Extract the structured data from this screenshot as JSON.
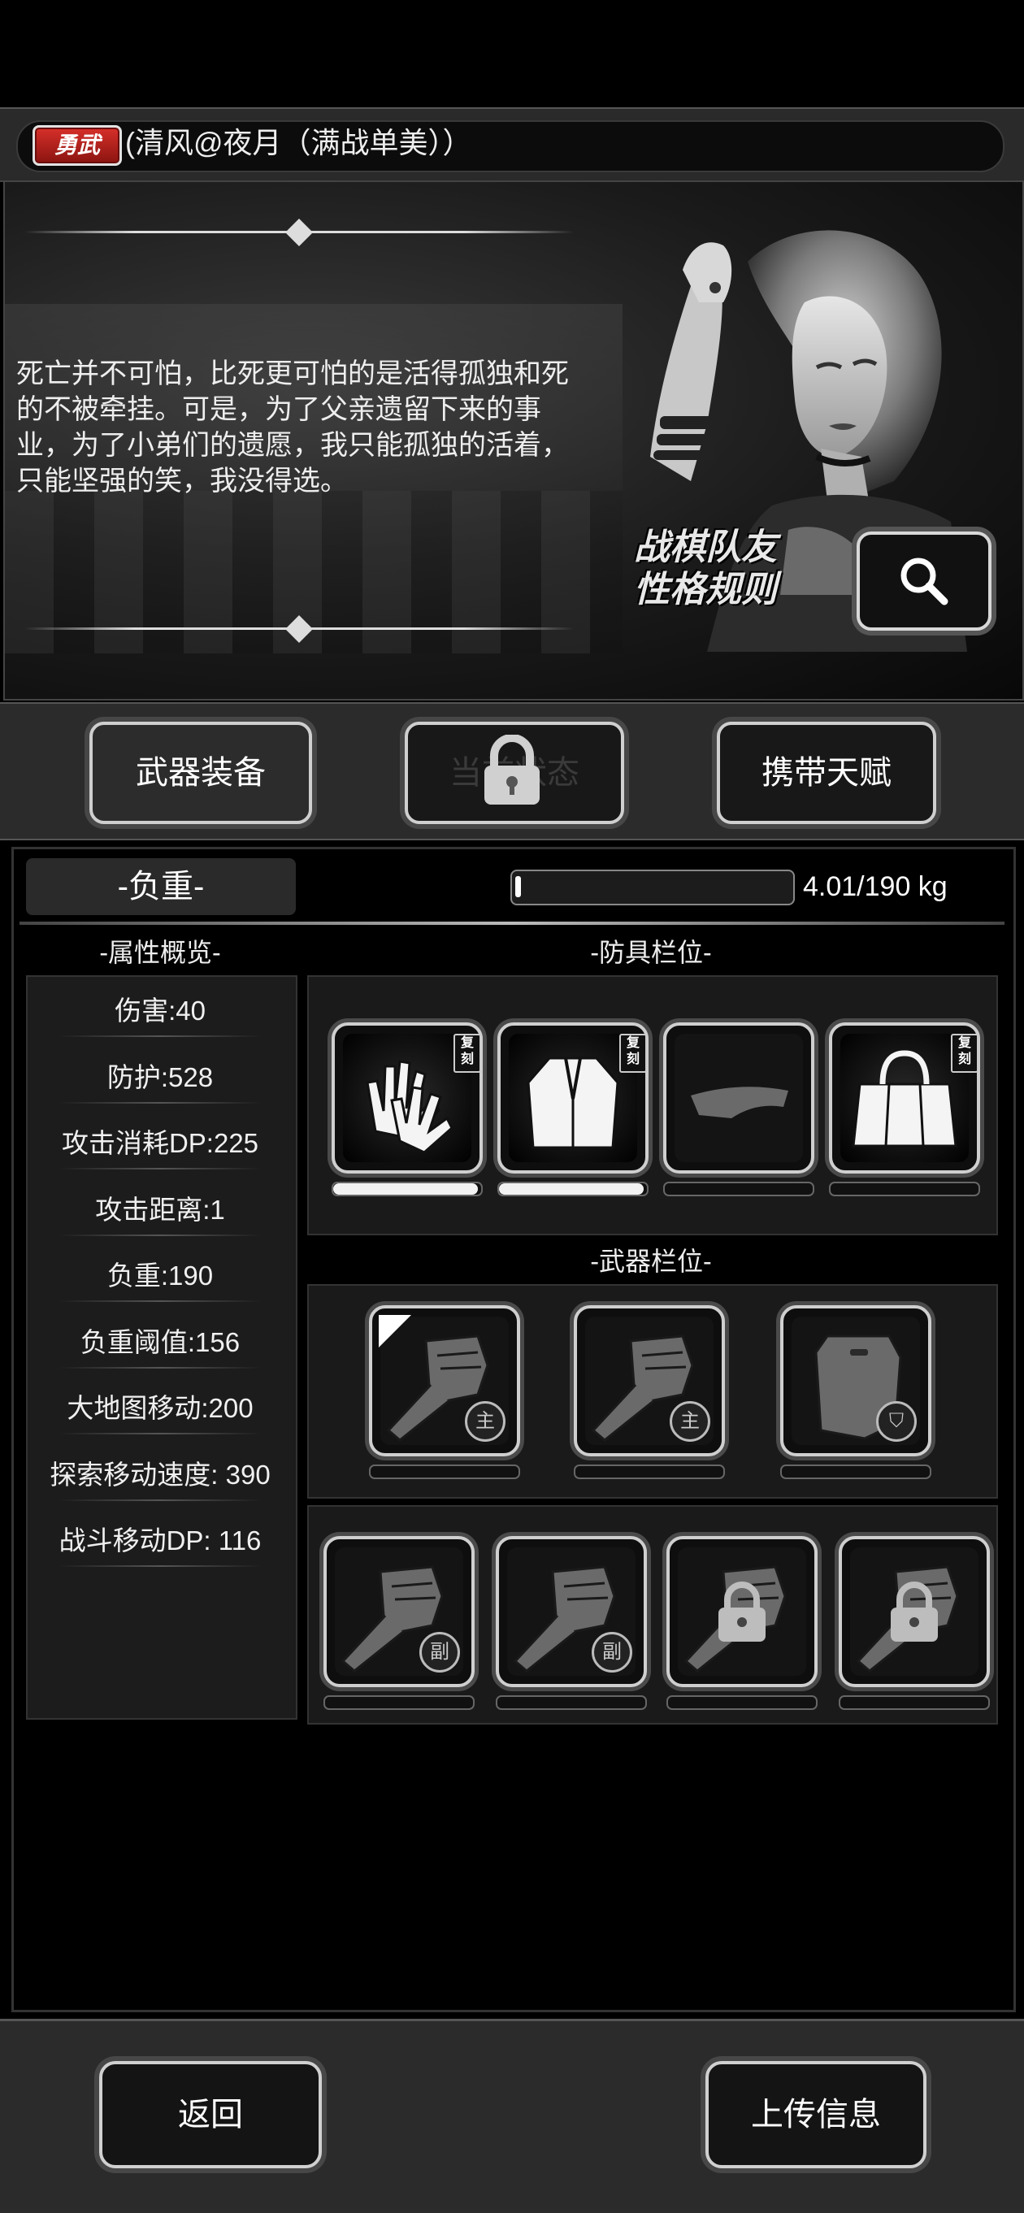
{
  "header": {
    "title_badge": "勇武",
    "player_name": "(清风@夜月（满战单美））"
  },
  "story": {
    "quote": "死亡并不可怕，比死更可怕的是活得孤独和死的不被牵挂。可是，为了父亲遗留下来的事业，为了小弟们的遗愿，我只能孤独的活着，只能坚强的笑，我没得选。",
    "rules_line1": "战棋队友",
    "rules_line2": "性格规则",
    "search_icon": "magnifier-icon"
  },
  "tabs": [
    {
      "label": "武器装备",
      "locked": false
    },
    {
      "label": "当前状态",
      "locked": true
    },
    {
      "label": "携带天赋",
      "locked": false
    }
  ],
  "weight": {
    "label": "-负重-",
    "current": 4.01,
    "max": 190,
    "value_text": "4.01/190 kg",
    "fill_fraction": 0.021
  },
  "attributes": {
    "section_title": "-属性概览-",
    "items": [
      "伤害:40",
      "防护:528",
      "攻击消耗DP:225",
      "攻击距离:1",
      "负重:190",
      "负重阈值:156",
      "大地图移动:200",
      "探索移动速度:  390",
      "战斗移动DP:  116"
    ]
  },
  "armor": {
    "section_title": "-防具栏位-",
    "tag": "复刻",
    "slots": [
      {
        "icon": "gloves-icon",
        "durability": 1.0,
        "tagged": true
      },
      {
        "icon": "coat-icon",
        "durability": 1.0,
        "tagged": true
      },
      {
        "icon": "visor-cap-icon",
        "durability": 0.0,
        "tagged": false
      },
      {
        "icon": "bag-icon",
        "durability": 0.0,
        "tagged": true
      }
    ]
  },
  "weapons": {
    "section_title": "-武器栏位-",
    "main_label": "主",
    "sub_label": "副",
    "main_slots": [
      {
        "icon": "fist-icon",
        "badge": "主"
      },
      {
        "icon": "fist-icon",
        "badge": "主"
      },
      {
        "icon": "shield-icon",
        "badge": "shield"
      }
    ],
    "sub_slots": [
      {
        "icon": "fist-icon",
        "badge": "副",
        "locked": false
      },
      {
        "icon": "fist-icon",
        "badge": "副",
        "locked": false
      },
      {
        "icon": "fist-icon",
        "badge": "",
        "locked": true
      },
      {
        "icon": "fist-icon",
        "badge": "",
        "locked": true
      }
    ]
  },
  "footer": {
    "back_label": "返回",
    "upload_label": "上传信息"
  }
}
